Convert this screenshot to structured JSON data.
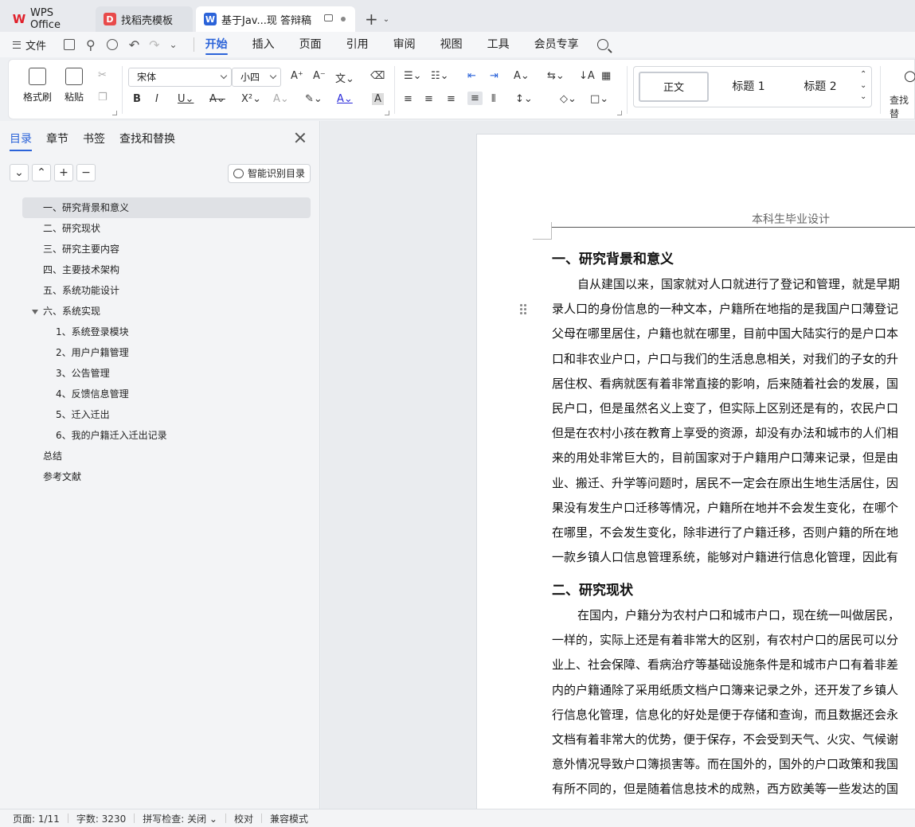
{
  "tabs": [
    {
      "label": "WPS Office",
      "icon": "wps-logo-icon"
    },
    {
      "label": "找稻壳模板",
      "icon": "docer-logo-icon"
    },
    {
      "label": "基于Jav...现 答辩稿",
      "icon": "word-doc-icon"
    }
  ],
  "menu": {
    "file": "文件",
    "tabs": [
      "开始",
      "插入",
      "页面",
      "引用",
      "审阅",
      "视图",
      "工具",
      "会员专享"
    ],
    "active_tab": "开始"
  },
  "ribbon": {
    "format_painter": "格式刷",
    "paste": "粘贴",
    "font_name": "宋体",
    "font_size": "小四",
    "styles": [
      "正文",
      "标题 1",
      "标题 2"
    ],
    "find": "查找替"
  },
  "nav": {
    "tabs": [
      "目录",
      "章节",
      "书签",
      "查找和替换"
    ],
    "smart_toc": "智能识别目录",
    "toc": [
      {
        "label": "一、研究背景和意义",
        "level": 1
      },
      {
        "label": "二、研究现状",
        "level": 1
      },
      {
        "label": "三、研究主要内容",
        "level": 1
      },
      {
        "label": "四、主要技术架构",
        "level": 1
      },
      {
        "label": "五、系统功能设计",
        "level": 1
      },
      {
        "label": "六、系统实现",
        "level": 1
      },
      {
        "label": "1、系统登录模块",
        "level": 2
      },
      {
        "label": "2、用户户籍管理",
        "level": 2
      },
      {
        "label": "3、公告管理",
        "level": 2
      },
      {
        "label": "4、反馈信息管理",
        "level": 2
      },
      {
        "label": "5、迁入迁出",
        "level": 2
      },
      {
        "label": "6、我的户籍迁入迁出记录",
        "level": 2
      },
      {
        "label": "总结",
        "level": 1
      },
      {
        "label": "参考文献",
        "level": 1
      }
    ]
  },
  "document": {
    "header": "本科生毕业设计",
    "section1_title": "一、研究背景和意义",
    "section1_lines": [
      "自从建国以来，国家就对人口就进行了登记和管理，就是早期",
      "录人口的身份信息的一种文本，户籍所在地指的是我国户口薄登记",
      "父母在哪里居住，户籍也就在哪里，目前中国大陆实行的是户口本",
      "口和非农业户口，户口与我们的生活息息相关，对我们的子女的升",
      "居住权、看病就医有着非常直接的影响，后来随着社会的发展，国",
      "民户口，但是虽然名义上变了，但实际上区别还是有的，农民户口",
      "但是在农村小孩在教育上享受的资源，却没有办法和城市的人们相",
      "来的用处非常巨大的，目前国家对于户籍用户口薄来记录，但是由",
      "业、搬迁、升学等问题时，居民不一定会在原出生地生活居住，因",
      "果没有发生户口迁移等情况，户籍所在地并不会发生变化，在哪个",
      "在哪里，不会发生变化，除非进行了户籍迁移，否则户籍的所在地",
      "一款乡镇人口信息管理系统，能够对户籍进行信息化管理，因此有"
    ],
    "section2_title": "二、研究现状",
    "section2_lines": [
      "在国内，户籍分为农村户口和城市户口，现在统一叫做居民，",
      "一样的，实际上还是有着非常大的区别，有农村户口的居民可以分",
      "业上、社会保障、看病治疗等基础设施条件是和城市户口有着非差",
      "内的户籍通除了采用纸质文档户口簿来记录之外，还开发了乡镇人",
      "行信息化管理，信息化的好处是便于存储和查询，而且数据还会永",
      "文档有着非常大的优势，便于保存，不会受到天气、火灾、气候谢",
      "意外情况导致户口簿损害等。而在国外的，国外的户口政策和我国",
      "有所不同的，但是随着信息技术的成熟，西方欧美等一些发达的国"
    ]
  },
  "status": {
    "page": "页面: 1/11",
    "words": "字数: 3230",
    "spell": "拼写检查: 关闭",
    "proof": "校对",
    "compat": "兼容模式"
  }
}
